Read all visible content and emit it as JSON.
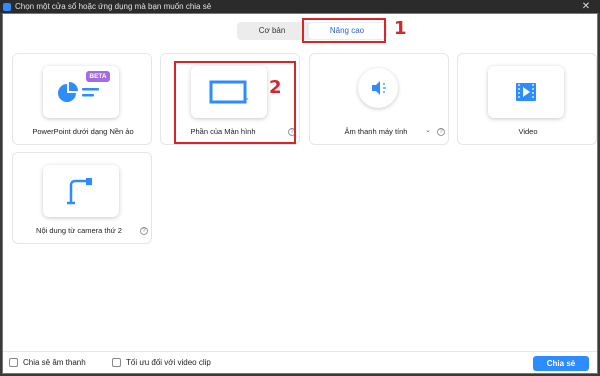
{
  "window": {
    "title": "Chọn một cửa sổ hoặc ứng dụng mà bạn muốn chia sẻ"
  },
  "tabs": [
    {
      "label": "Cơ bản",
      "active": false
    },
    {
      "label": "Nâng cao",
      "active": true
    }
  ],
  "cards": [
    {
      "label": "PowerPoint dưới dạng Nền ảo",
      "badge": "BETA",
      "icon": "powerpoint-background-icon"
    },
    {
      "label": "Phần của Màn hình",
      "icon": "screen-portion-icon"
    },
    {
      "label": "Âm thanh máy tính",
      "icon": "computer-audio-icon"
    },
    {
      "label": "Video",
      "icon": "video-icon"
    },
    {
      "label": "Nội dung từ camera thứ 2",
      "icon": "second-camera-icon"
    }
  ],
  "annotations": {
    "tab_number": "1",
    "card_number": "2"
  },
  "footer": {
    "share_audio_label": "Chia sẻ âm thanh",
    "optimize_video_label": "Tối ưu đối với video clip",
    "share_button": "Chia sẻ"
  },
  "colors": {
    "accent": "#2d8cff",
    "annotation": "#d4262b",
    "badge": "#a66be0"
  }
}
